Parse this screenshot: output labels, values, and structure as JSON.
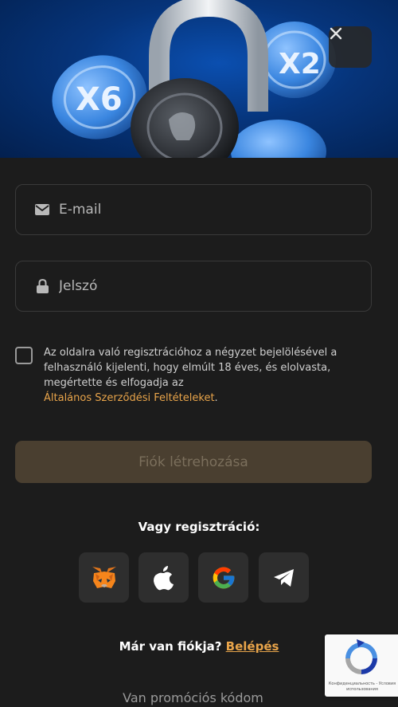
{
  "close_label": "×",
  "form": {
    "email_placeholder": "E-mail",
    "password_placeholder": "Jelszó"
  },
  "terms": {
    "text": "Az oldalra való regisztrációhoz a négyzet bejelölésével a felhasználó kijelenti, hogy elmúlt 18 éves, és elolvasta, megértette és elfogadja az",
    "link": "Általános Szerződési Feltételeket",
    "suffix": "."
  },
  "create_button": "Fiók létrehozása",
  "or_register": "Vagy regisztráció:",
  "social": [
    {
      "name": "metamask-icon"
    },
    {
      "name": "apple-icon"
    },
    {
      "name": "google-icon"
    },
    {
      "name": "telegram-icon"
    }
  ],
  "login": {
    "question": "Már van fiókja?",
    "link": "Belépés"
  },
  "promo": "Van promóciós kódom",
  "recaptcha": {
    "text": "Конфиденциальность - Условия использования"
  },
  "hero": {
    "coin_left": "X6",
    "coin_right": "X2"
  },
  "colors": {
    "accent": "#e8a44a",
    "background": "#1c1c1c",
    "button_disabled": "#4a3f30"
  }
}
